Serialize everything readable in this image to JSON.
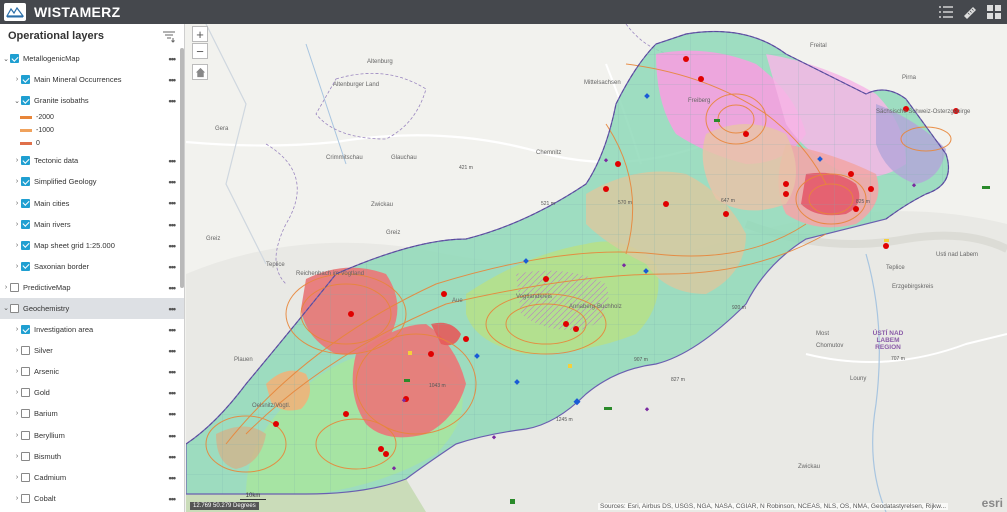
{
  "app": {
    "title": "WISTAMERZ"
  },
  "header": {
    "tools": [
      "layer-list-icon",
      "measure-icon",
      "app-grid-icon"
    ]
  },
  "panel": {
    "title": "Operational layers",
    "layers": [
      {
        "label": "MetallogenicMap",
        "level": 0,
        "checked": true,
        "expanded": true,
        "selected": false
      },
      {
        "label": "Main Mineral Occurrences",
        "level": 1,
        "checked": true,
        "expanded": false
      },
      {
        "label": "Granite isobaths",
        "level": 1,
        "checked": true,
        "expanded": true
      }
    ],
    "legend": [
      {
        "label": "-2000",
        "color": "#e8863a"
      },
      {
        "label": "-1000",
        "color": "#f0a25c"
      },
      {
        "label": "0",
        "color": "#e0704a"
      }
    ],
    "layers2": [
      {
        "label": "Tectonic data",
        "level": 1,
        "checked": true
      },
      {
        "label": "Simplified Geology",
        "level": 1,
        "checked": true
      },
      {
        "label": "Main cities",
        "level": 1,
        "checked": true
      },
      {
        "label": "Main rivers",
        "level": 1,
        "checked": true
      },
      {
        "label": "Map sheet grid 1:25.000",
        "level": 1,
        "checked": true
      },
      {
        "label": "Saxonian border",
        "level": 1,
        "checked": true
      },
      {
        "label": "PredictiveMap",
        "level": 0,
        "checked": false,
        "expanded": false
      },
      {
        "label": "Geochemistry",
        "level": 0,
        "checked": false,
        "expanded": true,
        "selected": true
      },
      {
        "label": "Investigation area",
        "level": 1,
        "checked": true
      },
      {
        "label": "Silver",
        "level": 1,
        "checked": false
      },
      {
        "label": "Arsenic",
        "level": 1,
        "checked": false
      },
      {
        "label": "Gold",
        "level": 1,
        "checked": false
      },
      {
        "label": "Barium",
        "level": 1,
        "checked": false
      },
      {
        "label": "Beryllium",
        "level": 1,
        "checked": false
      },
      {
        "label": "Bismuth",
        "level": 1,
        "checked": false
      },
      {
        "label": "Cadmium",
        "level": 1,
        "checked": false
      },
      {
        "label": "Cobalt",
        "level": 1,
        "checked": false
      }
    ]
  },
  "map": {
    "places": [
      "Freital",
      "Pirna",
      "Altenburg",
      "Altenburger Land",
      "Mittelsachsen",
      "Freiberg",
      "Gera",
      "Crimmitschau",
      "Glauchau",
      "Chemnitz",
      "Zwickau",
      "Greiz",
      "Reichenbach im Vogtland",
      "Aue",
      "Annaberg-Buchholz",
      "Plauen",
      "Oelsnitz/Vogtl.",
      "Teplice",
      "Usti nad Labem",
      "Most",
      "Chomutov",
      "Louny",
      "Zwickau",
      "Greiz",
      "Teplice",
      "Erzgebirgskreis",
      "Vogtlandkreis",
      "Sächsische Schweiz-Osterzgebirge"
    ],
    "regions": [
      "ÚSTÍ NAD LABEM REGION"
    ],
    "elevations": [
      "421 m",
      "521 m",
      "570 m",
      "647 m",
      "825 m",
      "920 m",
      "907 m",
      "827 m",
      "1245 m",
      "1043 m",
      "707 m"
    ],
    "attribution": "Sources: Esri, Airbus DS, USGS, NGA, NASA, CGIAR, N Robinson, NCEAS, NLS, OS, NMA, Geodatastyrelsen, Rijkw...",
    "coordinates": "12.769 50.279 Degrees",
    "scale": "10km",
    "brand": "esri"
  },
  "colors": {
    "header": "#45484d",
    "accent": "#1f9fd1",
    "granite": "#e87a7a",
    "gneiss": "#f5a0e0",
    "schist": "#8fd9b8"
  }
}
